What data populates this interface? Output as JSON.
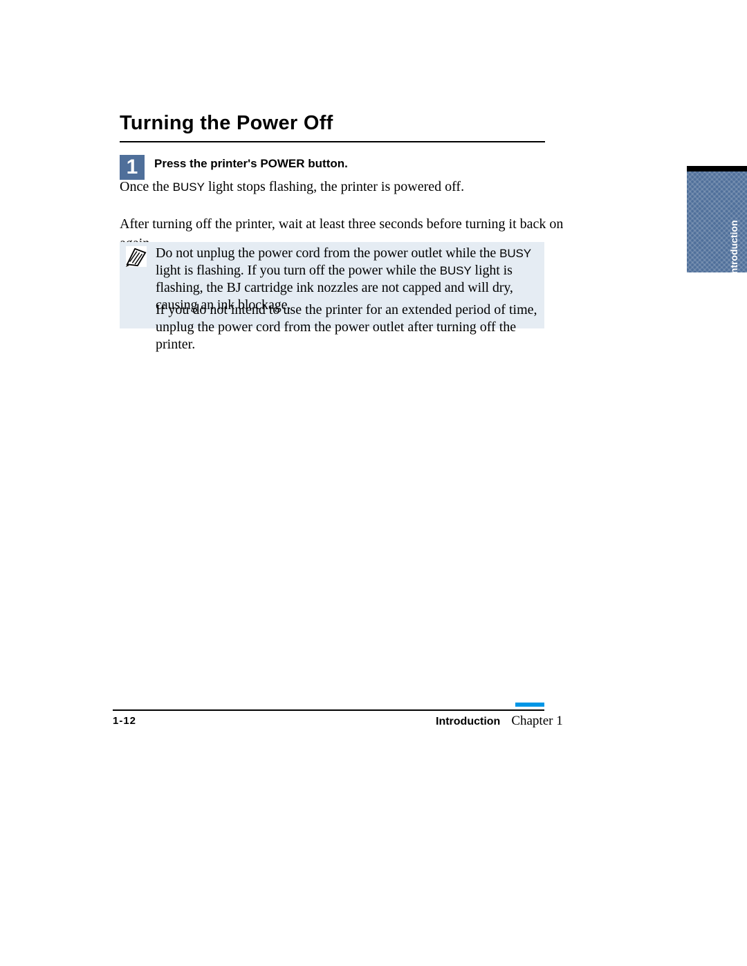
{
  "heading": "Turning the Power Off",
  "step": {
    "number": "1",
    "title": "Press the printer's POWER button."
  },
  "body": {
    "para1_pre": "Once the ",
    "para1_sc": "BUSY",
    "para1_post": " light stops flashing, the printer is powered off.",
    "para2": "After turning off the printer, wait at least three seconds before turning it back on again."
  },
  "note": {
    "p1_a": "Do not unplug the power cord from the power outlet while the ",
    "p1_sc1": "BUSY",
    "p1_b": " light is flashing. If you turn off the power while the ",
    "p1_sc2": "BUSY",
    "p1_c": " light is flashing, the BJ cartridge ink nozzles are not capped and will dry, causing an ink blockage.",
    "p2": "If you do not intend to use the printer for an extended period of time, unplug the power cord from the power outlet after turning off the printer."
  },
  "side_tab": "Introduction",
  "footer": {
    "page": "1-12",
    "section": "Introduction",
    "chapter": "Chapter 1"
  }
}
